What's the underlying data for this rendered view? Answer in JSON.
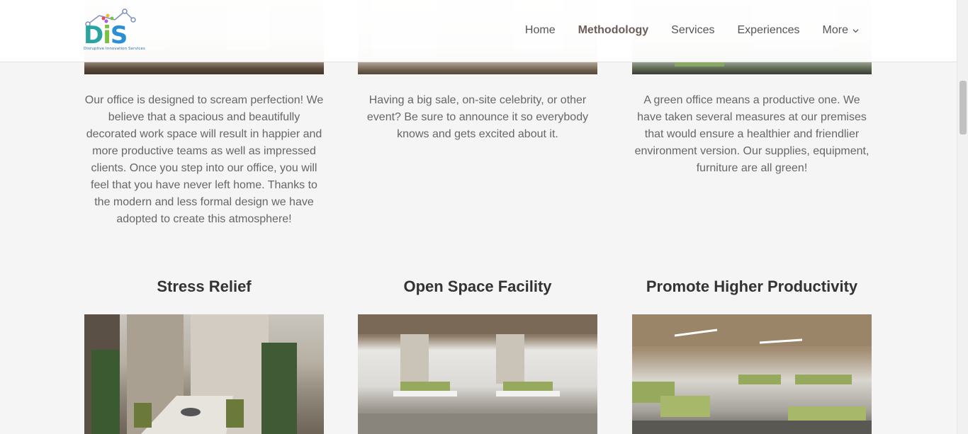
{
  "header": {
    "logo_text": "DIS",
    "logo_tagline": "Disruptive Innovation Services",
    "nav": [
      {
        "label": "Home",
        "active": false
      },
      {
        "label": "Methodology",
        "active": true
      },
      {
        "label": "Services",
        "active": false
      },
      {
        "label": "Experiences",
        "active": false
      },
      {
        "label": "More",
        "active": false,
        "has_dropdown": true
      }
    ]
  },
  "features": [
    {
      "text": "Our office is designed to scream perfection! We believe that a spacious and beautifully decorated work space will result in happier and more productive teams as well as impressed clients. Once you step into our office, you will feel that you have never left home. Thanks to the modern and less formal design we have adopted to create this atmosphere!"
    },
    {
      "text": "Having a big sale, on-site celebrity, or other event? Be sure to announce it so everybody knows and gets excited about it."
    },
    {
      "text": "A green office means a productive one. We have taken several measures at our premises that would ensure a healthier and friendlier environment version. Our supplies, equipment, furniture are all green!"
    }
  ],
  "sections": [
    {
      "title": "Stress Relief",
      "image_icon": "meeting-room-photo"
    },
    {
      "title": "Open Space Facility",
      "image_icon": "open-office-photo"
    },
    {
      "title": "Promote Higher Productivity",
      "image_icon": "workstations-photo"
    }
  ],
  "colors": {
    "accent_green": "#7bc043",
    "accent_teal": "#2aa4a0",
    "accent_blue": "#2b8fd6",
    "nav_active": "#6a5d5a"
  }
}
